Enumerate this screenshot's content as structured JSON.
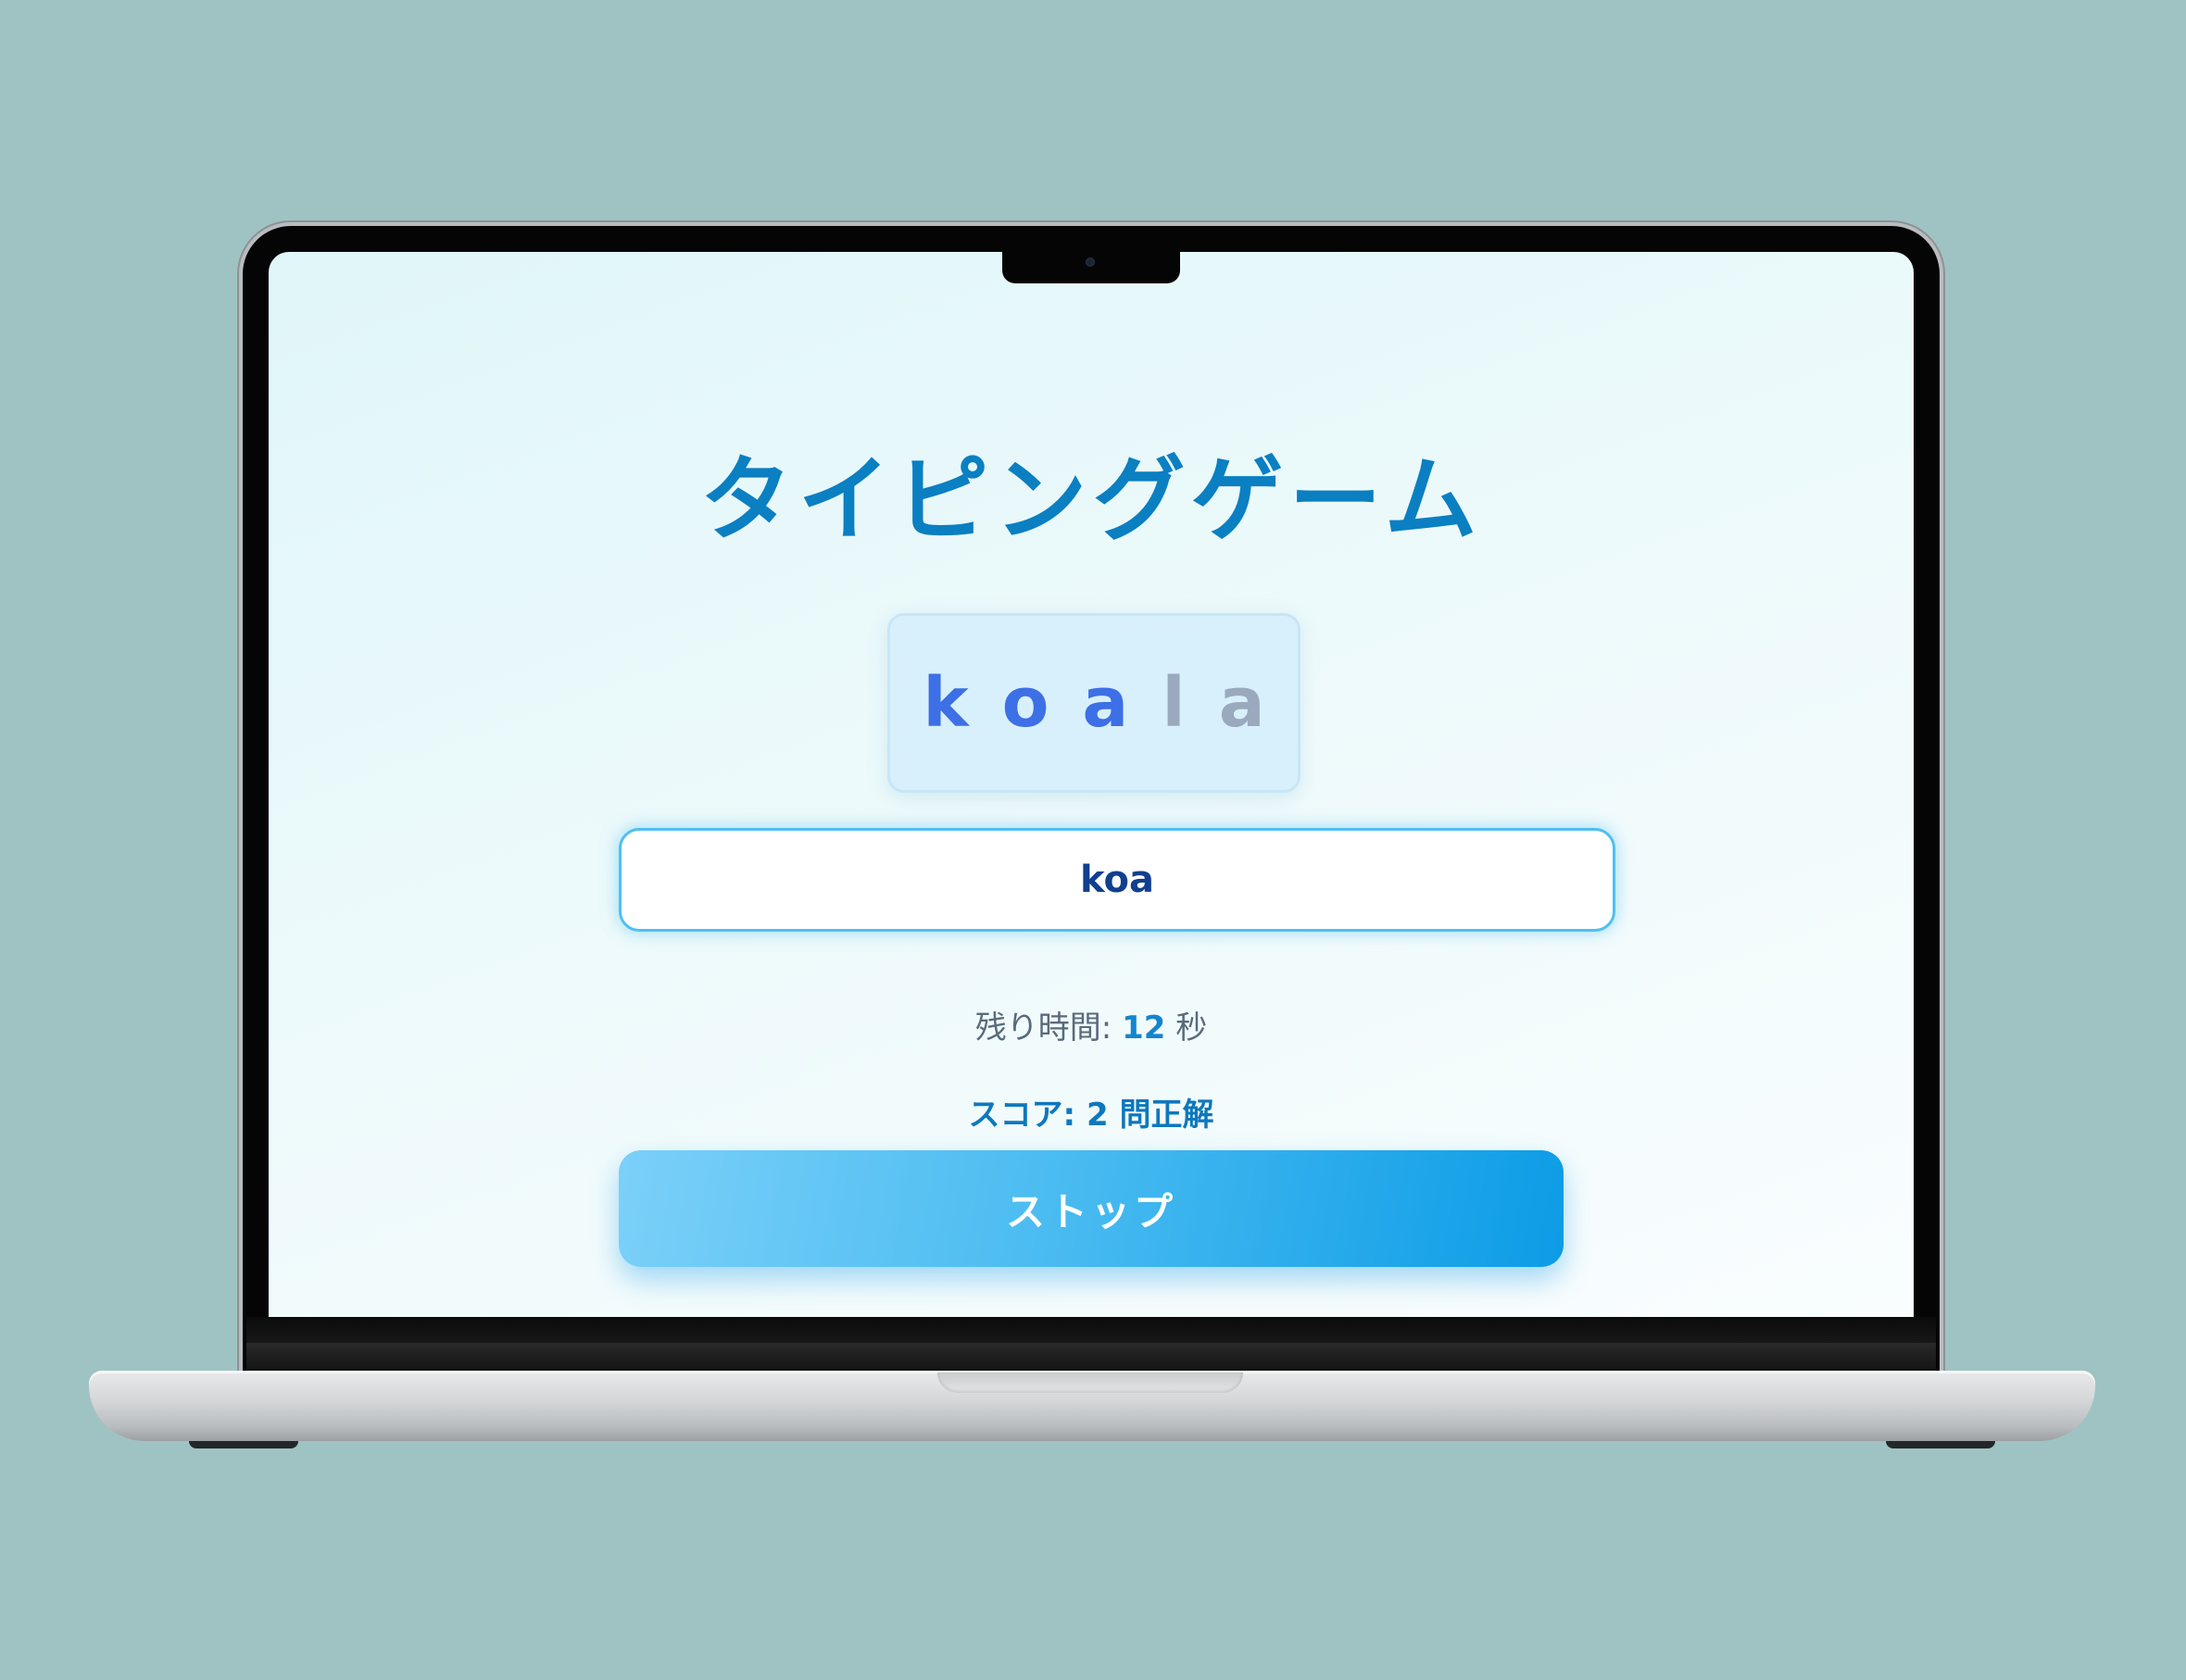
{
  "app": {
    "title": "タイピングゲーム"
  },
  "target_word": {
    "word": "koala",
    "letters": [
      {
        "char": "k",
        "state": "typed"
      },
      {
        "char": "o",
        "state": "typed"
      },
      {
        "char": "a",
        "state": "typed"
      },
      {
        "char": "l",
        "state": "pending"
      },
      {
        "char": "a",
        "state": "pending"
      }
    ]
  },
  "input": {
    "value": "koa"
  },
  "timer": {
    "label": "残り時間: ",
    "value": "12",
    "unit": " 秒"
  },
  "score": {
    "text": "スコア: 2 問正解"
  },
  "controls": {
    "stop_label": "ストップ"
  },
  "colors": {
    "title": "#0a7fc2",
    "typed_letter": "#3d6fe6",
    "pending_letter": "#9aa9bd",
    "accent": "#0c9ce6",
    "backdrop": "#9fc3c3"
  }
}
